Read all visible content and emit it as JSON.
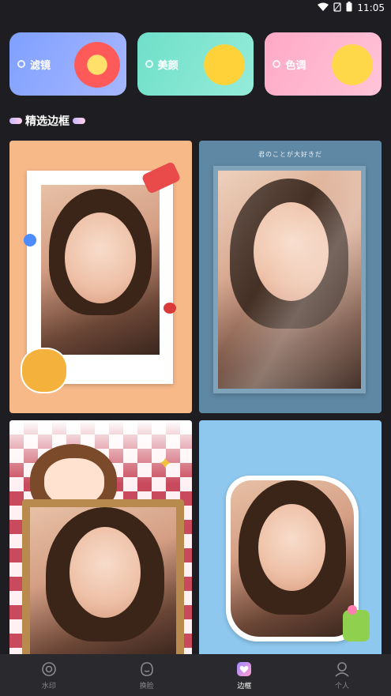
{
  "status": {
    "time": "11:05"
  },
  "quick_actions": [
    {
      "label": "滤镜",
      "color": "#8fa7ff"
    },
    {
      "label": "美颜",
      "color": "#79e3cf"
    },
    {
      "label": "色调",
      "color": "#ffb6cf"
    }
  ],
  "section": {
    "title": "精选边框"
  },
  "frames": [
    {
      "caption": ""
    },
    {
      "caption": "君のことが大好きだ"
    },
    {
      "caption": ""
    },
    {
      "caption": ""
    }
  ],
  "tabs": [
    {
      "label": "水印",
      "icon": "watermark-icon"
    },
    {
      "label": "换脸",
      "icon": "face-icon"
    },
    {
      "label": "边框",
      "icon": "frame-icon"
    },
    {
      "label": "个人",
      "icon": "person-icon"
    }
  ],
  "active_tab": "边框"
}
